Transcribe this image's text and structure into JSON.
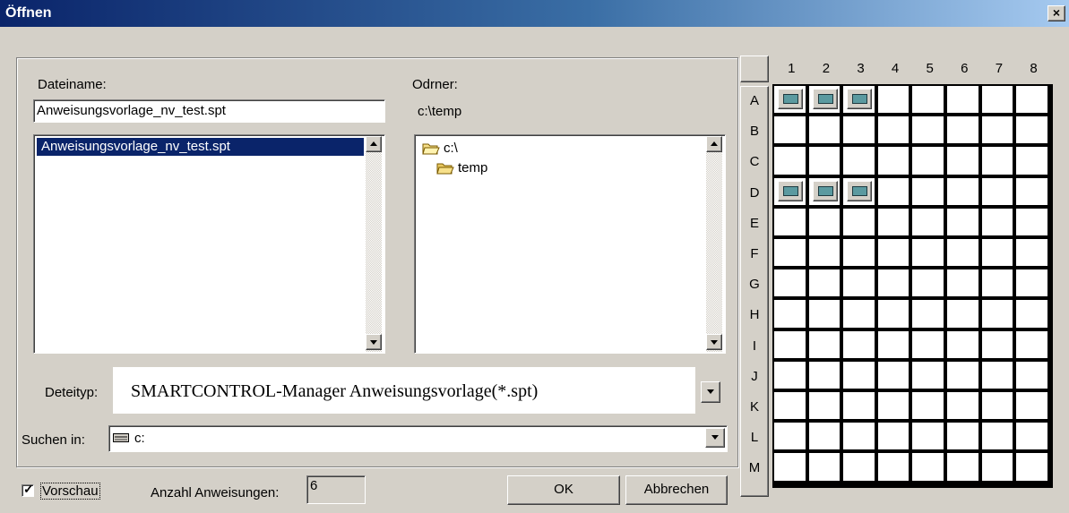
{
  "window": {
    "title": "Öffnen",
    "close_label": "×"
  },
  "filename": {
    "label": "Dateiname:",
    "value": "Anweisungsvorlage_nv_test.spt"
  },
  "files_list": {
    "items": [
      "Anweisungsvorlage_nv_test.spt"
    ],
    "selected_index": 0
  },
  "folder": {
    "label": "Odrner:",
    "current": "c:\\temp",
    "tree": [
      "c:\\",
      "temp"
    ]
  },
  "file_type": {
    "label": "Deteityp:",
    "value": "SMARTCONTROL-Manager Anweisungsvorlage(*.spt)"
  },
  "search_in": {
    "label": "Suchen in:",
    "value": "c:"
  },
  "preview": {
    "label": "Vorschau",
    "checked": true
  },
  "count": {
    "label": "Anzahl Anweisungen:",
    "value": "6"
  },
  "buttons": {
    "ok": "OK",
    "cancel": "Abbrechen"
  },
  "grid": {
    "columns": [
      "1",
      "2",
      "3",
      "4",
      "5",
      "6",
      "7",
      "8"
    ],
    "rows": [
      "A",
      "B",
      "C",
      "D",
      "E",
      "F",
      "G",
      "H",
      "I",
      "J",
      "K",
      "L",
      "M"
    ],
    "occupied": [
      "A1",
      "A2",
      "A3",
      "D1",
      "D2",
      "D3"
    ]
  },
  "colors": {
    "title_start": "#0a246a",
    "title_end": "#a6caf0",
    "selection": "#0a246a",
    "chip": "#5b9aa0"
  }
}
